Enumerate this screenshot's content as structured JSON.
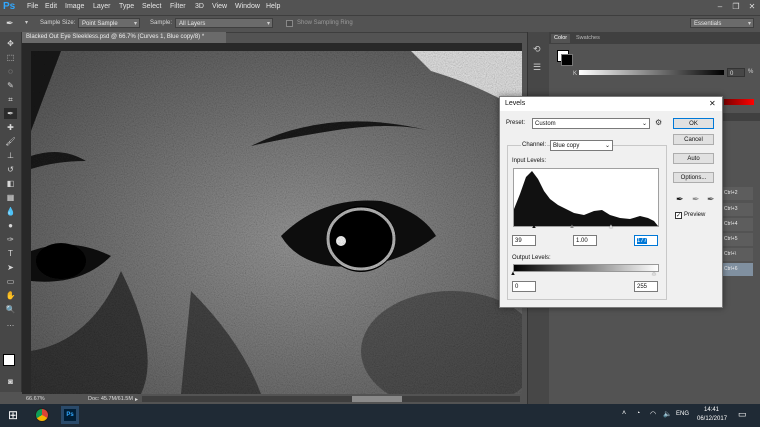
{
  "app": {
    "logo": "Ps"
  },
  "menu": [
    "File",
    "Edit",
    "Image",
    "Layer",
    "Type",
    "Select",
    "Filter",
    "3D",
    "View",
    "Window",
    "Help"
  ],
  "options_bar": {
    "sample_size_label": "Sample Size:",
    "sample_size_value": "Point Sample",
    "sample_label": "Sample:",
    "sample_value": "All Layers",
    "sampling_ring_label": "Show Sampling Ring",
    "workspace": "Essentials"
  },
  "document": {
    "tab_title": "Blacked Out Eye Sleekless.psd @ 66.7% (Curves 1, Blue copy/8) *",
    "zoom": "66.67%",
    "doc_info": "Doc: 45.7M/61.5M"
  },
  "panels": {
    "color_tab": "Color",
    "swatches_tab": "Swatches",
    "k_label": "K",
    "k_value": "0",
    "k_percent": "%",
    "layer_shortcuts": [
      "Ctrl+2",
      "Ctrl+3",
      "Ctrl+4",
      "Ctrl+5",
      "Ctrl+\\",
      "Ctrl+6"
    ]
  },
  "levels_dialog": {
    "title": "Levels",
    "preset_label": "Preset:",
    "preset_value": "Custom",
    "channel_label": "Channel:",
    "channel_value": "Blue copy",
    "input_levels_label": "Input Levels:",
    "input_black": "39",
    "input_gamma": "1.00",
    "input_white": "177",
    "output_levels_label": "Output Levels:",
    "output_black": "0",
    "output_white": "255",
    "ok_label": "OK",
    "cancel_label": "Cancel",
    "auto_label": "Auto",
    "options_label": "Options...",
    "preview_label": "Preview",
    "preview_checked": true
  },
  "taskbar": {
    "language": "ENG",
    "time": "14:41",
    "date": "06/12/2017"
  },
  "colors": {
    "ps_bg": "#535353",
    "ps_accent": "#31a8ff",
    "taskbar": "#1f2a35"
  }
}
